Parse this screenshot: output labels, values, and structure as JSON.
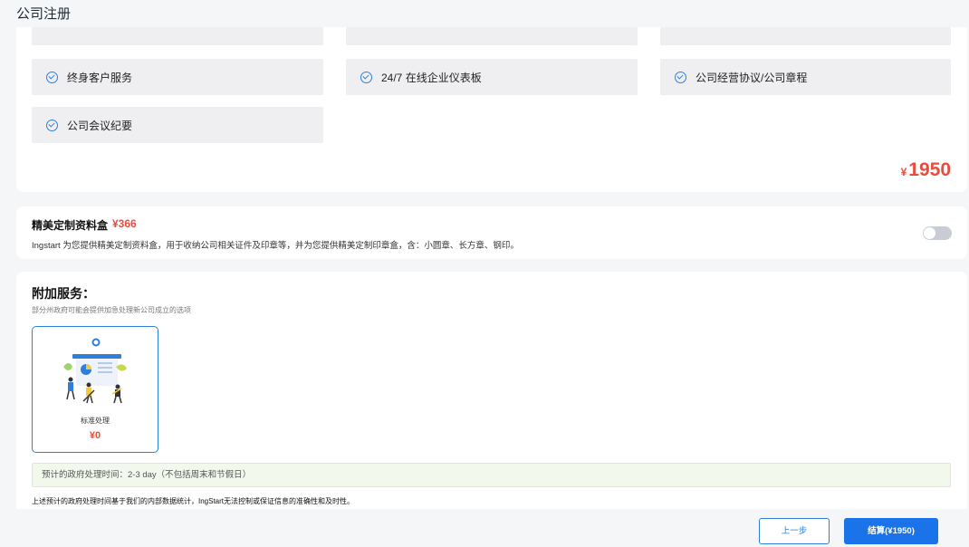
{
  "header": {
    "title": "公司注册"
  },
  "features": {
    "row2": [
      "终身客户服务",
      "24/7 在线企业仪表板",
      "公司经营协议/公司章程"
    ],
    "row3": [
      "公司会议纪要"
    ],
    "icon": "check-circle-icon"
  },
  "package_price": {
    "currency": "¥",
    "amount": "1950"
  },
  "box": {
    "title": "精美定制资料盒",
    "price": "¥366",
    "description": "Ingstart 为您提供精美定制资料盒，用于收纳公司相关证件及印章等，并为您提供精美定制印章盒，含：小圆章、长方章、钢印。",
    "enabled": false
  },
  "additional": {
    "heading": "附加服务：",
    "subtitle": "部分州政府可能会提供加急处理新公司成立的选项",
    "option": {
      "name": "标准处理",
      "price": "¥0",
      "selected": true
    },
    "notice": "预计的政府处理时间：2-3 day（不包括周末和节假日）",
    "disclaimer": "上述预计的政府处理时间基于我们的内部数据统计，IngStart无法控制或保证信息的准确性和及时性。"
  },
  "footer": {
    "prev_label": "上一步",
    "pay_label": "结算(¥1950)"
  },
  "colors": {
    "accent": "#1a73e8",
    "price": "#e74c3c",
    "notice_bg": "#f2f9ec"
  }
}
